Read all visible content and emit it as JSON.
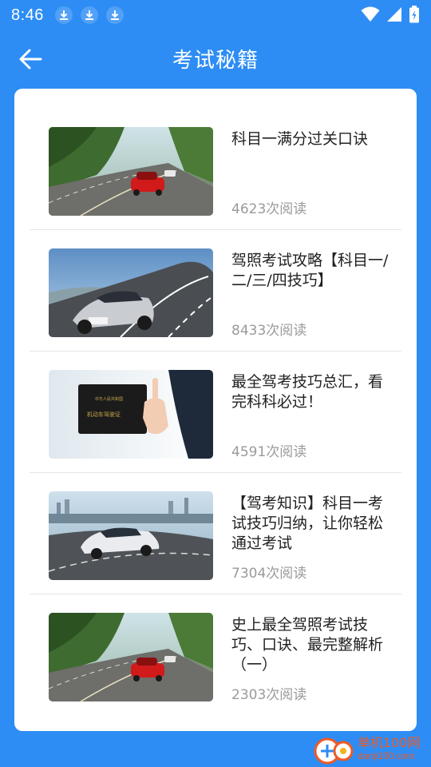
{
  "status_bar": {
    "time": "8:46",
    "download_icons": [
      "download-icon",
      "download-icon",
      "download-icon"
    ],
    "right_icons": [
      "wifi-icon",
      "signal-icon",
      "battery-icon"
    ]
  },
  "header": {
    "back_icon": "arrow-left-icon",
    "title": "考试秘籍"
  },
  "articles": [
    {
      "title": "科目一满分过关口诀",
      "reads": "4623次阅读",
      "image": "red-car-road"
    },
    {
      "title": "驾照考试攻略【科目一/二/三/四技巧】",
      "reads": "8433次阅读",
      "image": "silver-car-curve"
    },
    {
      "title": "最全驾考技巧总汇，看完科科必过！",
      "reads": "4591次阅读",
      "image": "license-in-hand"
    },
    {
      "title": "【驾考知识】科目一考试技巧归纳，让你轻松通过考试",
      "reads": "7304次阅读",
      "image": "white-car-city"
    },
    {
      "title": "史上最全驾照考试技巧、口诀、最完整解析（一）",
      "reads": "2303次阅读",
      "image": "red-car-road"
    }
  ],
  "watermark": {
    "name": "单机100网",
    "url": "danji100.com"
  },
  "colors": {
    "primary": "#2d8df5",
    "watermark": "#f15a24"
  }
}
